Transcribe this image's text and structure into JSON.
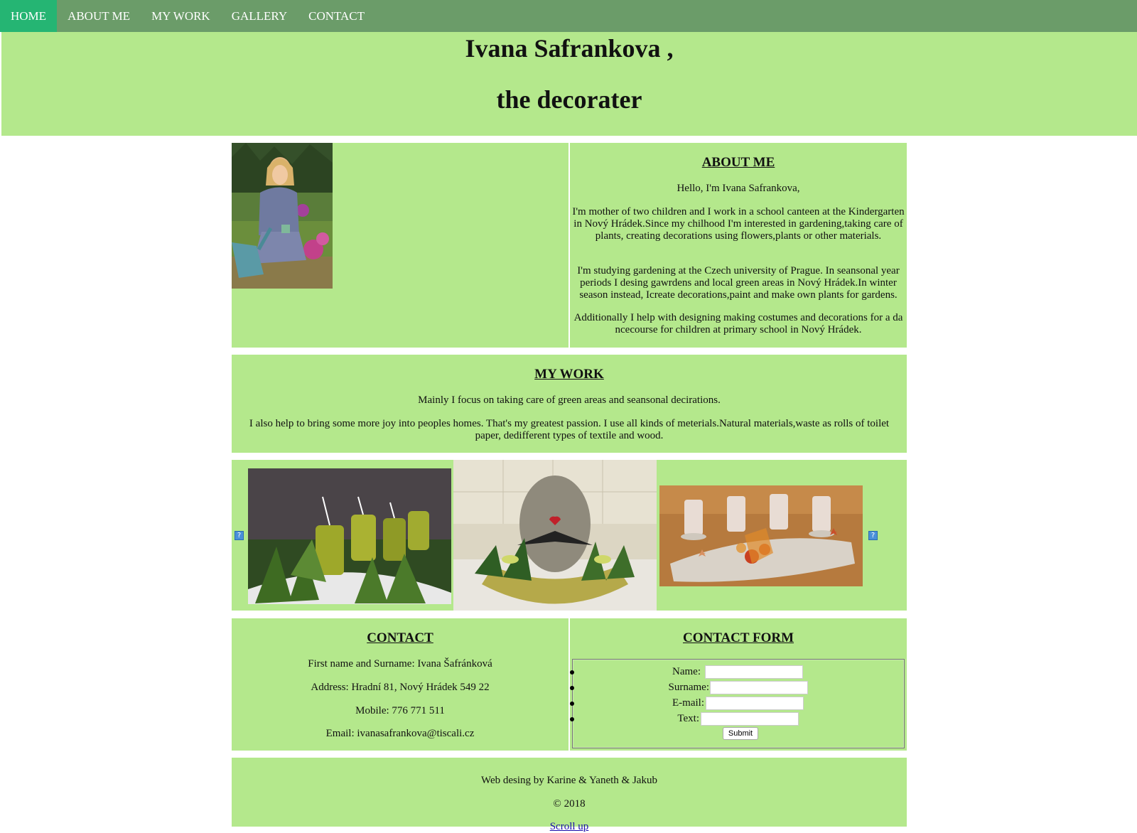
{
  "nav": {
    "items": [
      {
        "label": "HOME",
        "active": true
      },
      {
        "label": "ABOUT ME",
        "active": false
      },
      {
        "label": "MY WORK",
        "active": false
      },
      {
        "label": "GALLERY",
        "active": false
      },
      {
        "label": "CONTACT",
        "active": false
      }
    ]
  },
  "header": {
    "title_line1": "Ivana Safrankova ,",
    "title_line2": "the decorater"
  },
  "about": {
    "heading": "ABOUT ME",
    "p1": "Hello, I'm Ivana Safrankova,",
    "p2": "I'm mother of two children and I work in a school canteen at the Kindergarten in Nový Hrádek.Since my chilhood I'm interested in gardening,taking care of plants, creating decorations using flowers,plants or other materials.",
    "p3": "I'm studying gardening at the Czech university of Prague. In seansonal year periods I desing gawrdens and local green areas in Nový Hrádek.In winter season instead, Icreate decorations,paint and make own plants for gardens.",
    "p4": "Additionally I help with designing making costumes and decorations for a da ncecourse for children at primary school in Nový Hrádek."
  },
  "work": {
    "heading": "MY WORK",
    "p1": "Mainly I focus on taking care of green areas and seansonal decirations.",
    "p2": "I also help to bring some more joy into peoples homes. That's my greatest passion. I use all kinds of meterials.Natural materials,waste as rolls of toilet paper, dedifferent types of textile and wood."
  },
  "gallery": {
    "broken_icon": "?"
  },
  "contact": {
    "heading": "CONTACT",
    "name": "First name and Surname: Ivana Šafránková",
    "address": "Address: Hradní 81, Nový Hrádek 549 22",
    "mobile": "Mobile: 776 771 511",
    "email": "Email: ivanasafrankova@tiscali.cz"
  },
  "form": {
    "heading": "CONTACT FORM",
    "name_label": "Name:",
    "surname_label": "Surname:",
    "email_label": "E-mail:",
    "text_label": "Text:",
    "submit_label": "Submit"
  },
  "footer": {
    "credit": "Web desing by Karine & Yaneth & Jakub",
    "copyright": "© 2018",
    "scroll_up": "Scroll up"
  },
  "colors": {
    "nav_bg": "#6b9c69",
    "nav_active": "#25b573",
    "panel_green": "#b4e88c"
  }
}
